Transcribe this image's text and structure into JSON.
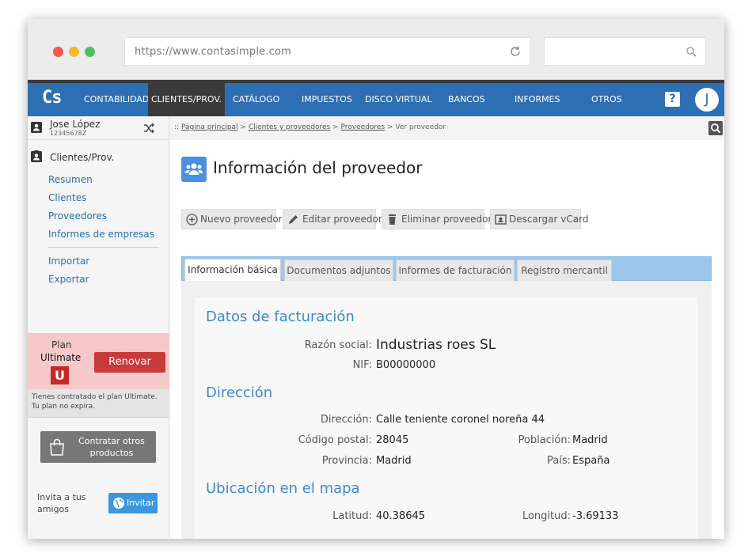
{
  "browser": {
    "url": "https://www.contasimple.com",
    "dot_colors": [
      "#ee5a4f",
      "#f5b731",
      "#4cc25d"
    ]
  },
  "nav": {
    "logo": "Cs",
    "items": [
      {
        "label": "CONTABILIDAD",
        "active": false
      },
      {
        "label": "CLIENTES/PROV.",
        "active": true
      },
      {
        "label": "CATÁLOGO",
        "active": false
      },
      {
        "label": "IMPUESTOS",
        "active": false
      },
      {
        "label": "DISCO VIRTUAL",
        "active": false
      },
      {
        "label": "BANCOS",
        "active": false
      },
      {
        "label": "INFORMES",
        "active": false
      },
      {
        "label": "OTROS",
        "active": false
      }
    ],
    "help": "?",
    "avatar": "J",
    "accent": "#2d6fb3"
  },
  "user": {
    "name": "Jose López",
    "id": "12345678Z"
  },
  "sidebar": {
    "section_title": "Clientes/Prov.",
    "links": [
      "Resumen",
      "Clientes",
      "Proveedores",
      "Informes de empresas"
    ],
    "links2": [
      "Importar",
      "Exportar"
    ],
    "plan_label": "Plan",
    "plan_name": "Ultimate",
    "plan_badge": "U",
    "renew_label": "Renovar",
    "plan_note": "Tienes contratado el plan Ultimate. Tu plan no expira.",
    "contract_label": "Contratar otros productos",
    "invite_text": "Invita a tus amigos",
    "invite_label": "Invitar"
  },
  "breadcrumb": {
    "prefix": ":: ",
    "items": [
      "Página principal",
      "Clientes y proveedores",
      "Proveedores"
    ],
    "current": "Ver proveedor",
    "separator": " > "
  },
  "page": {
    "title": "Información del proveedor",
    "actions": [
      "Nuevo proveedor",
      "Editar proveedor",
      "Eliminar proveedor",
      "Descargar vCard"
    ],
    "tabs": [
      "Información básica",
      "Documentos adjuntos",
      "Informes de facturación",
      "Registro mercantil"
    ]
  },
  "billing": {
    "heading": "Datos de facturación",
    "razon_label": "Razón social:",
    "razon_value": "Industrias roes SL",
    "nif_label": "NIF:",
    "nif_value": "B00000000"
  },
  "address": {
    "heading": "Dirección",
    "dir_label": "Dirección:",
    "dir_value": "Calle teniente coronel noreña 44",
    "cp_label": "Código postal:",
    "cp_value": "28045",
    "poblacion_label": "Población:",
    "poblacion_value": "Madrid",
    "provincia_label": "Provincia:",
    "provincia_value": "Madrid",
    "pais_label": "País:",
    "pais_value": "España"
  },
  "map": {
    "heading": "Ubicación en el mapa",
    "lat_label": "Latitud:",
    "lat_value": "40.38645",
    "lon_label": "Longitud:",
    "lon_value": "-3.69133"
  }
}
